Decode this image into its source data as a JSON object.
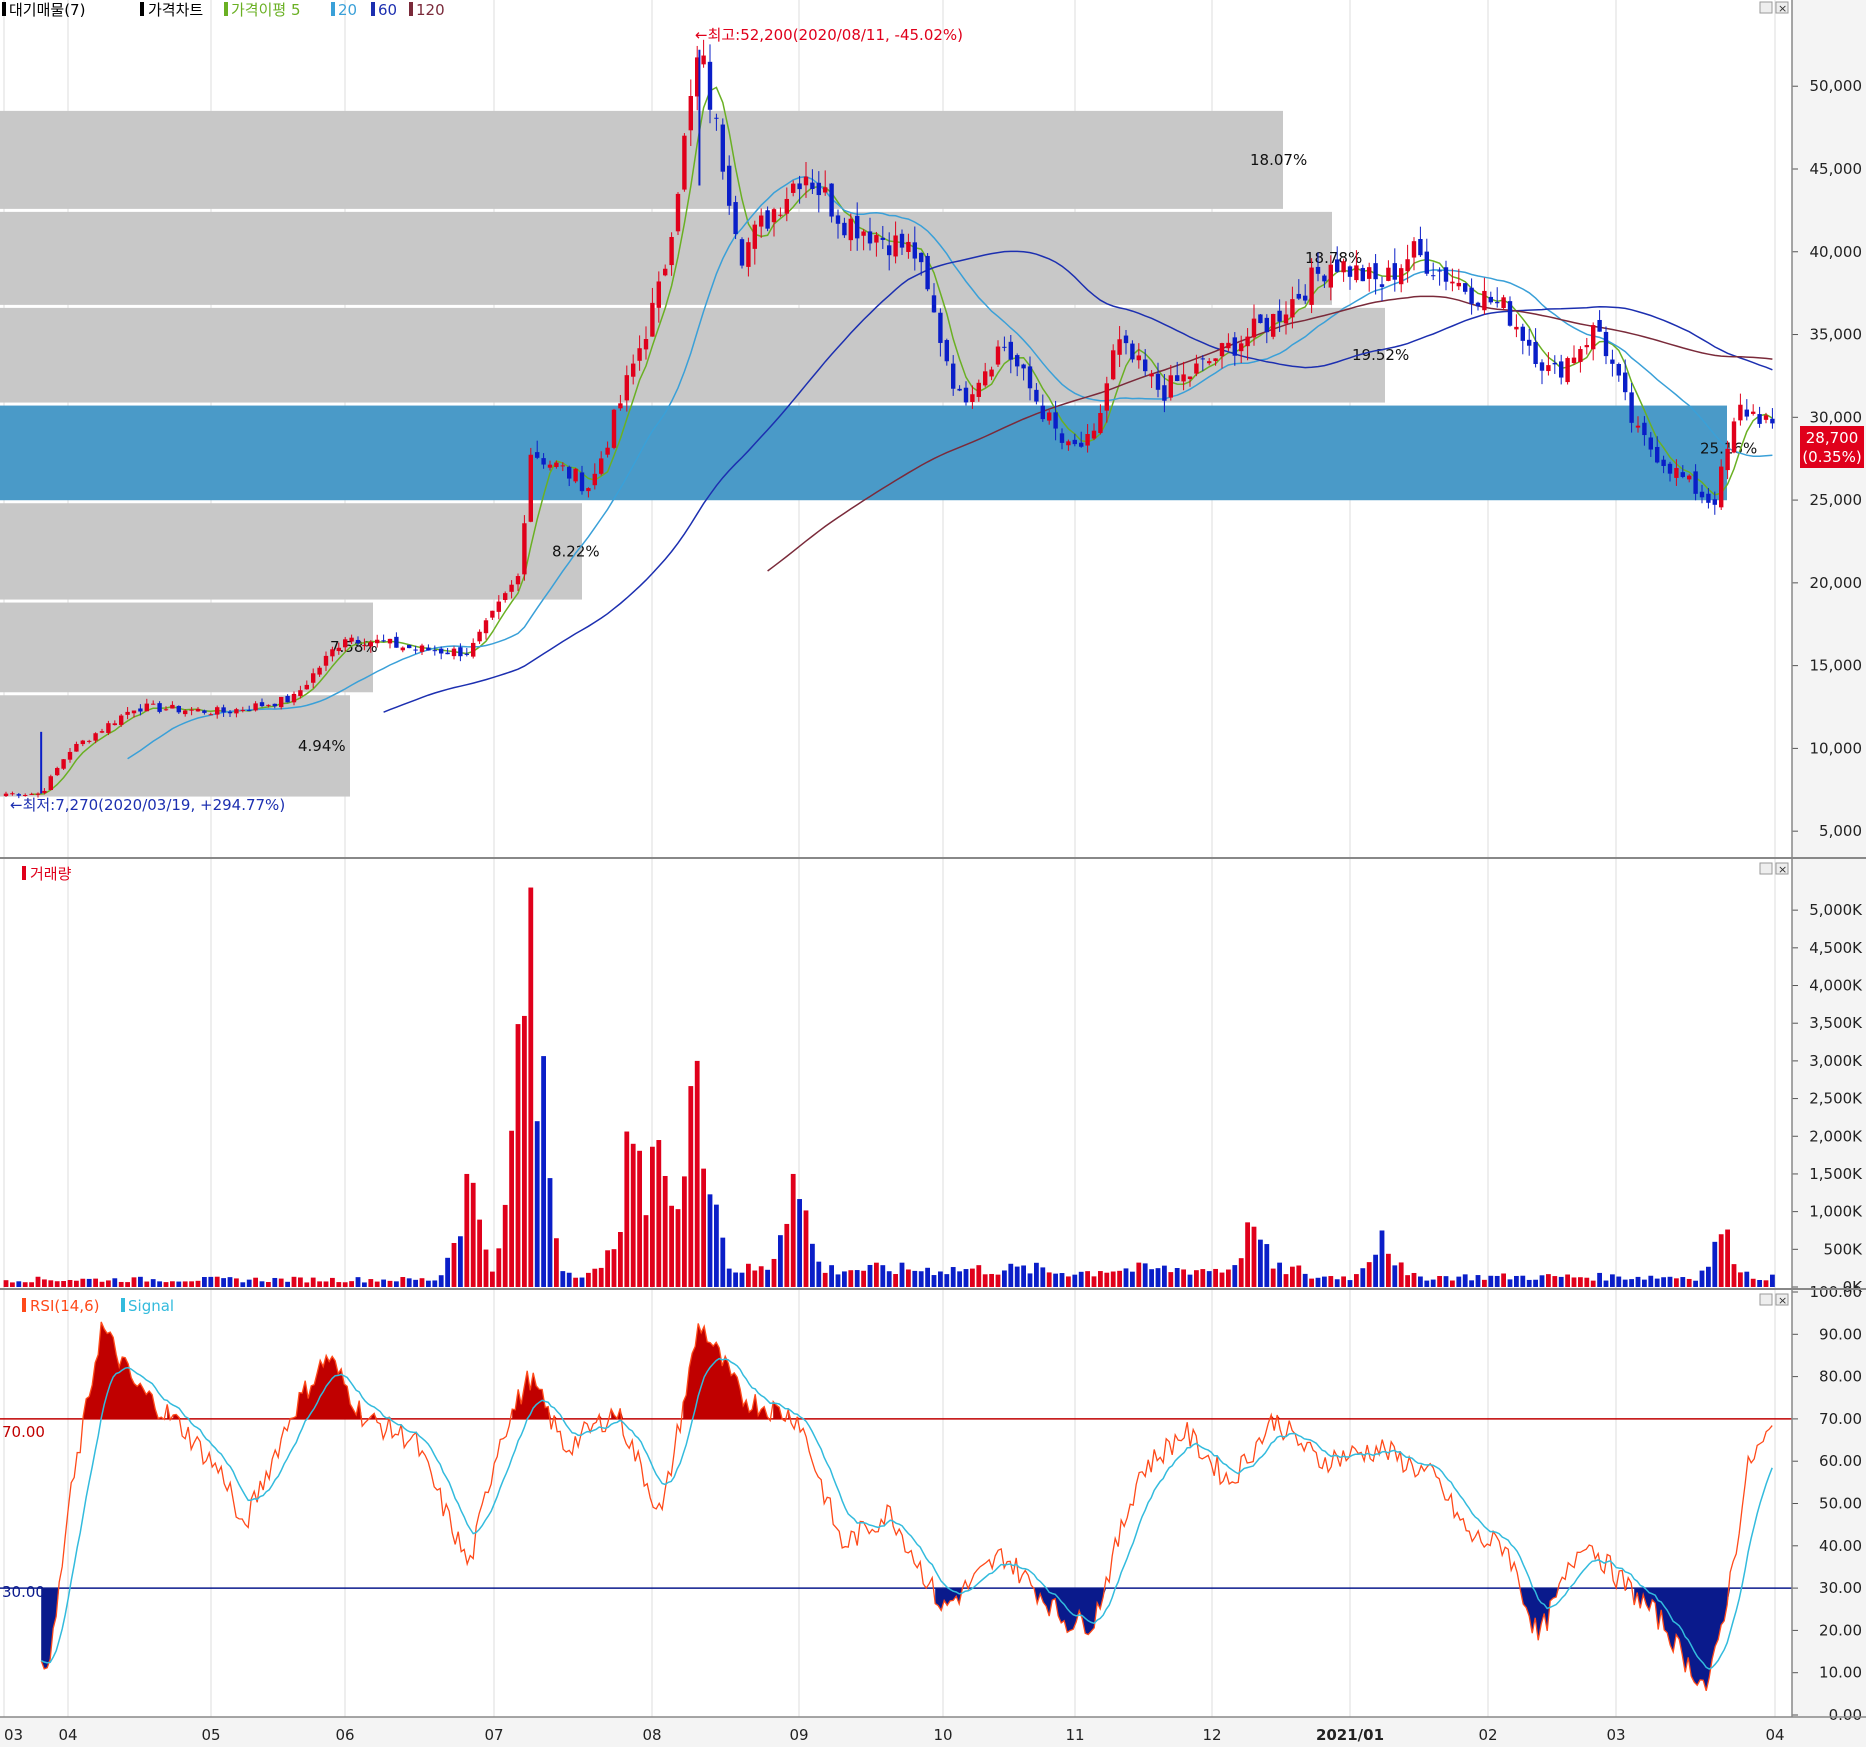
{
  "colors": {
    "up": "#e0001b",
    "down": "#0a1ec8",
    "ma5": "#6ab023",
    "ma20": "#3aa0d8",
    "ma60": "#1c2fb0",
    "ma120": "#7a2a3a",
    "rsi": "#ff4a1a",
    "signal": "#33bbdd",
    "vp_band": "#c8c8c8",
    "vp_max_band": "#4a9ac8",
    "overbought": "#c00000",
    "oversold": "#0a1a8c",
    "price_tag_bg": "#e0001b"
  },
  "price_panel": {
    "legend": [
      {
        "label": "대기매물(7)",
        "color": "#000000"
      },
      {
        "label": "가격차트",
        "color": "#000000"
      },
      {
        "label": "가격이평 5",
        "color": "#6ab023"
      },
      {
        "label": "20",
        "color": "#3aa0d8"
      },
      {
        "label": "60",
        "color": "#1c2fb0"
      },
      {
        "label": "120",
        "color": "#7a2a3a"
      }
    ],
    "high_label": "←최고:52,200(2020/08/11, -45.02%)",
    "low_label": "←최저:7,270(2020/03/19, +294.77%)",
    "current_price": "28,700",
    "current_change": "(0.35%)",
    "y_ticks": [
      "50,000",
      "45,000",
      "40,000",
      "35,000",
      "30,000",
      "25,000",
      "20,000",
      "15,000",
      "10,000",
      "5,000"
    ]
  },
  "volume_panel": {
    "legend": "거래량",
    "y_ticks": [
      "5,000K",
      "4,500K",
      "4,000K",
      "3,500K",
      "3,000K",
      "2,500K",
      "2,000K",
      "1,500K",
      "1,000K",
      "500K",
      "0K"
    ]
  },
  "rsi_panel": {
    "legend_rsi": "RSI(14,6)",
    "legend_signal": "Signal",
    "level_high_label": "70.00",
    "level_low_label": "30.00",
    "y_ticks": [
      "100.00",
      "90.00",
      "80.00",
      "70.00",
      "60.00",
      "50.00",
      "40.00",
      "30.00",
      "20.00",
      "10.00",
      "0.00"
    ]
  },
  "x_axis": {
    "labels": [
      "03",
      "04",
      "05",
      "06",
      "07",
      "08",
      "09",
      "10",
      "11",
      "12",
      "2021/01",
      "02",
      "03",
      "04"
    ]
  },
  "chart_data": [
    {
      "type": "candlestick",
      "ylim": [
        3500,
        54000
      ],
      "x_labels": [
        "03",
        "04",
        "05",
        "06",
        "07",
        "08",
        "09",
        "10",
        "11",
        "12",
        "2021/01",
        "02",
        "03",
        "04"
      ],
      "close_series": [
        [
          "2020-03-19",
          7270
        ],
        [
          "2020-04-01",
          9800
        ],
        [
          "2020-04-15",
          12500
        ],
        [
          "2020-05-04",
          12200
        ],
        [
          "2020-05-20",
          13000
        ],
        [
          "2020-06-01",
          16800
        ],
        [
          "2020-06-15",
          16000
        ],
        [
          "2020-06-26",
          15800
        ],
        [
          "2020-07-06",
          20500
        ],
        [
          "2020-07-08",
          28000
        ],
        [
          "2020-07-20",
          25800
        ],
        [
          "2020-08-03",
          38000
        ],
        [
          "2020-08-11",
          52200
        ],
        [
          "2020-08-20",
          40000
        ],
        [
          "2020-09-02",
          45000
        ],
        [
          "2020-09-10",
          42000
        ],
        [
          "2020-09-25",
          40000
        ],
        [
          "2020-10-05",
          31000
        ],
        [
          "2020-10-15",
          34500
        ],
        [
          "2020-10-30",
          28000
        ],
        [
          "2020-11-05",
          28500
        ],
        [
          "2020-11-10",
          34500
        ],
        [
          "2020-11-20",
          31500
        ],
        [
          "2020-12-01",
          33500
        ],
        [
          "2020-12-15",
          36000
        ],
        [
          "2020-12-28",
          39500
        ],
        [
          "2021-01-08",
          38000
        ],
        [
          "2021-01-15",
          40000
        ],
        [
          "2021-01-26",
          38000
        ],
        [
          "2021-02-05",
          36500
        ],
        [
          "2021-02-15",
          32500
        ],
        [
          "2021-02-25",
          35500
        ],
        [
          "2021-03-05",
          29000
        ],
        [
          "2021-03-15",
          26000
        ],
        [
          "2021-03-20",
          24800
        ],
        [
          "2021-03-25",
          30500
        ],
        [
          "2021-03-30",
          30000
        ],
        [
          "2021-04-05",
          28700
        ]
      ],
      "extremes": {
        "high": 52200,
        "high_date": "2020/08/11",
        "low": 7270,
        "low_date": "2020/03/19"
      },
      "last_price": 28700,
      "last_change_pct": 0.35
    },
    {
      "type": "volume_profile",
      "bands": [
        {
          "price_low": 7000,
          "price_high": 13300,
          "pct": "4.94%"
        },
        {
          "price_low": 13300,
          "price_high": 18900,
          "pct": "7.58%"
        },
        {
          "price_low": 18900,
          "price_high": 24900,
          "pct": "8.22%"
        },
        {
          "price_low": 24900,
          "price_high": 30800,
          "pct": "25.16%"
        },
        {
          "price_low": 30800,
          "price_high": 36700,
          "pct": "19.52%"
        },
        {
          "price_low": 36700,
          "price_high": 42500,
          "pct": "18.78%"
        },
        {
          "price_low": 42500,
          "price_high": 48600,
          "pct": "18.07%"
        }
      ]
    },
    {
      "type": "bar",
      "name": "거래량",
      "ylim": [
        0,
        5400
      ],
      "unit": "K",
      "peaks": [
        [
          "2020-06-26",
          1500
        ],
        [
          "2020-07-08",
          5300
        ],
        [
          "2020-07-09",
          2200
        ],
        [
          "2020-07-28",
          1900
        ],
        [
          "2020-08-03",
          1950
        ],
        [
          "2020-08-11",
          3000
        ],
        [
          "2020-08-31",
          1500
        ],
        [
          "2020-12-10",
          800
        ],
        [
          "2021-01-08",
          750
        ],
        [
          "2021-03-22",
          700
        ]
      ]
    },
    {
      "type": "line",
      "ylim": [
        0,
        100
      ],
      "levels": [
        70,
        30
      ],
      "rsi_points": [
        [
          "2020-03-19",
          10
        ],
        [
          "2020-03-25",
          18
        ],
        [
          "2020-04-01",
          48
        ],
        [
          "2020-04-08",
          92
        ],
        [
          "2020-04-15",
          78
        ],
        [
          "2020-04-25",
          68
        ],
        [
          "2020-05-05",
          55
        ],
        [
          "2020-05-08",
          43
        ],
        [
          "2020-05-20",
          72
        ],
        [
          "2020-05-28",
          85
        ],
        [
          "2020-06-05",
          70
        ],
        [
          "2020-06-15",
          65
        ],
        [
          "2020-06-26",
          35
        ],
        [
          "2020-07-02",
          65
        ],
        [
          "2020-07-08",
          80
        ],
        [
          "2020-07-15",
          63
        ],
        [
          "2020-07-25",
          72
        ],
        [
          "2020-08-03",
          47
        ],
        [
          "2020-08-11",
          93
        ],
        [
          "2020-08-20",
          75
        ],
        [
          "2020-09-01",
          70
        ],
        [
          "2020-09-10",
          40
        ],
        [
          "2020-09-20",
          48
        ],
        [
          "2020-10-01",
          25
        ],
        [
          "2020-10-15",
          38
        ],
        [
          "2020-10-30",
          22
        ],
        [
          "2020-11-05",
          22
        ],
        [
          "2020-11-15",
          57
        ],
        [
          "2020-11-25",
          67
        ],
        [
          "2020-12-05",
          55
        ],
        [
          "2020-12-15",
          70
        ],
        [
          "2020-12-25",
          60
        ],
        [
          "2021-01-08",
          63
        ],
        [
          "2021-01-20",
          56
        ],
        [
          "2021-01-28",
          42
        ],
        [
          "2021-02-05",
          40
        ],
        [
          "2021-02-12",
          18
        ],
        [
          "2021-02-22",
          42
        ],
        [
          "2021-03-01",
          33
        ],
        [
          "2021-03-10",
          22
        ],
        [
          "2021-03-15",
          12
        ],
        [
          "2021-03-19",
          6
        ],
        [
          "2021-03-23",
          30
        ],
        [
          "2021-03-27",
          60
        ],
        [
          "2021-04-01",
          68
        ],
        [
          "2021-04-05",
          62
        ]
      ]
    }
  ]
}
